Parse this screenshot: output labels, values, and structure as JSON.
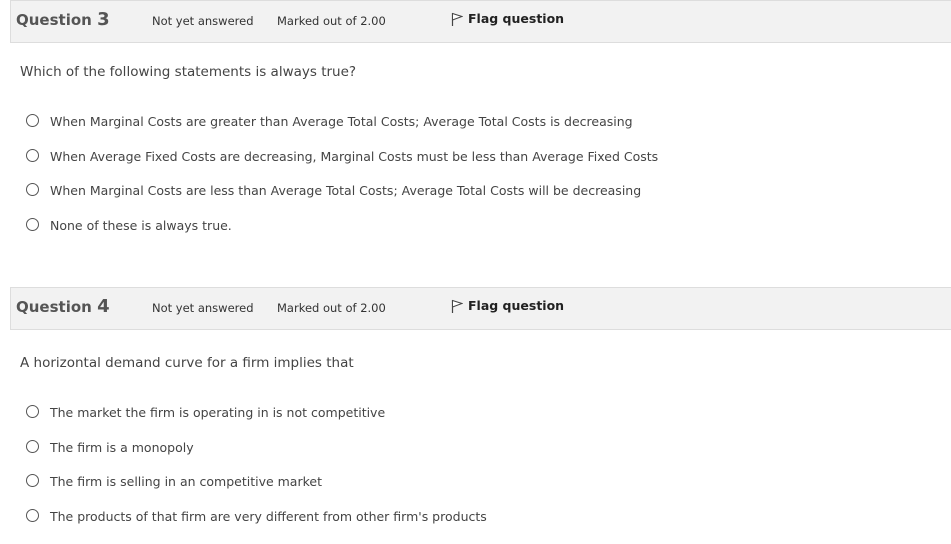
{
  "questions": [
    {
      "label": "Question",
      "number": "3",
      "status": "Not yet answered",
      "marks": "Marked out of 2.00",
      "flag_label": "Flag question",
      "text": "Which of the following statements is always true?",
      "options": [
        "When Marginal Costs are greater than Average Total Costs; Average Total Costs is decreasing",
        "When Average Fixed Costs are decreasing, Marginal Costs  must be less than Average Fixed Costs",
        "When Marginal Costs are less than Average Total Costs; Average Total Costs will be decreasing",
        "None of these is always true."
      ]
    },
    {
      "label": "Question",
      "number": "4",
      "status": "Not yet answered",
      "marks": "Marked out of 2.00",
      "flag_label": "Flag question",
      "text": "A horizontal demand curve for a firm implies that",
      "options": [
        "The market the firm is operating in is not competitive",
        "The firm is a monopoly",
        "The firm is selling in an competitive market",
        "The products of that firm are very different from other firm's products"
      ]
    }
  ],
  "colors": {
    "header_bg": "#f2f2f2",
    "header_border": "#dddddd",
    "text": "#444444"
  }
}
